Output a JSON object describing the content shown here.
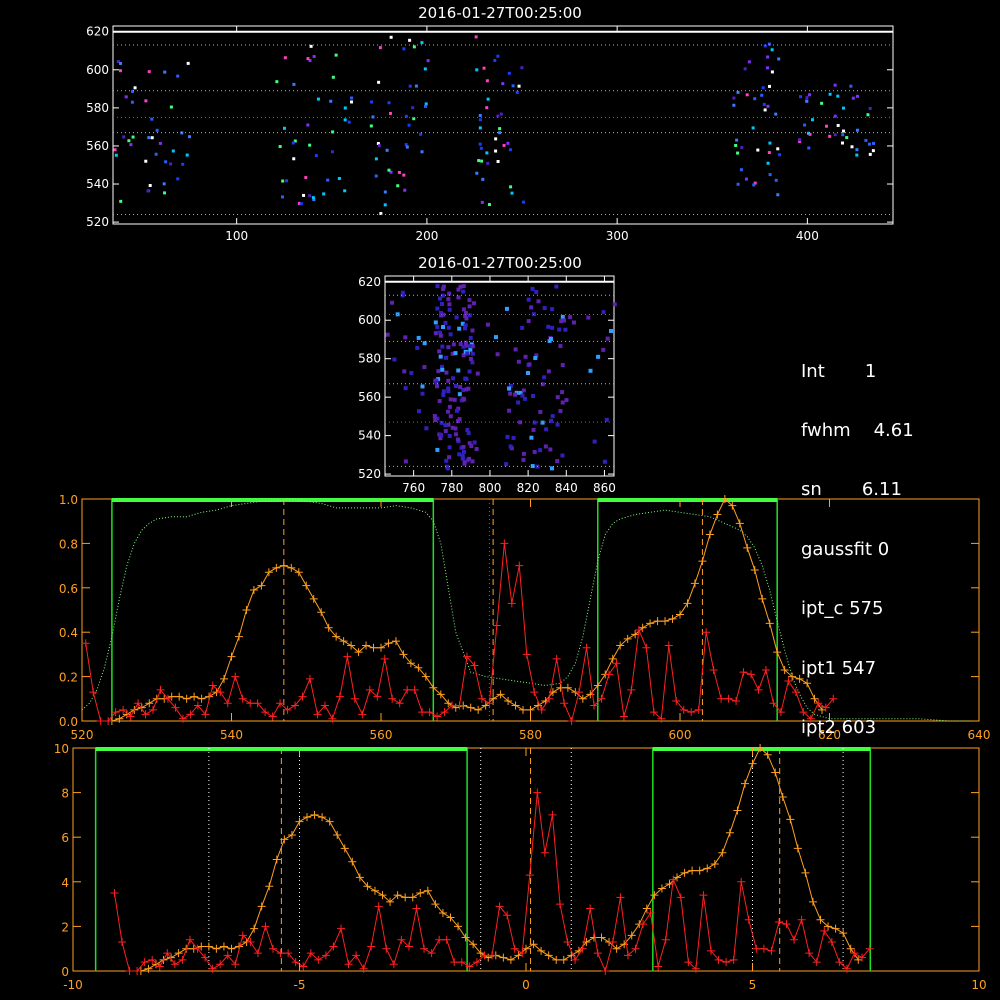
{
  "chart_data": [
    {
      "id": "top",
      "type": "heatmap",
      "title": "2016-01-27T00:25:00",
      "xlim": [
        35,
        445
      ],
      "ylim": [
        519,
        623
      ],
      "xticks": [
        100,
        200,
        300,
        400
      ],
      "yticks": [
        520,
        540,
        560,
        580,
        600,
        620
      ],
      "hlines_green": [
        524,
        567,
        589,
        613
      ],
      "hlines_red": [
        575
      ],
      "hlines_white": [
        620
      ],
      "pixel_clusters": [
        {
          "x_range": [
            35,
            75
          ],
          "y_range": [
            530,
            610
          ]
        },
        {
          "x_range": [
            120,
            160
          ],
          "y_range": [
            528,
            616
          ]
        },
        {
          "x_range": [
            170,
            200
          ],
          "y_range": [
            525,
            620
          ]
        },
        {
          "x_range": [
            225,
            250
          ],
          "y_range": [
            530,
            620
          ]
        },
        {
          "x_range": [
            358,
            385
          ],
          "y_range": [
            535,
            615
          ]
        },
        {
          "x_range": [
            395,
            435
          ],
          "y_range": [
            555,
            595
          ]
        }
      ]
    },
    {
      "id": "mid",
      "type": "heatmap",
      "title": "2016-01-27T00:25:00",
      "xlim": [
        745,
        865
      ],
      "ylim": [
        519,
        623
      ],
      "xticks": [
        760,
        780,
        800,
        820,
        840,
        860
      ],
      "yticks": [
        520,
        540,
        560,
        580,
        600,
        620
      ],
      "hlines_green": [
        524,
        567,
        589,
        613
      ],
      "hlines_red": [
        547,
        603
      ],
      "hlines_white": [
        620
      ]
    },
    {
      "id": "profile1",
      "type": "line",
      "xlim": [
        520,
        640
      ],
      "ylim": [
        0,
        1
      ],
      "xticks": [
        520,
        540,
        560,
        580,
        600,
        620,
        640
      ],
      "yticks": [
        0.0,
        0.2,
        0.4,
        0.6,
        0.8,
        1.0
      ],
      "ytick_labels": [
        "0.0",
        "0.2",
        "0.4",
        "0.6",
        "0.8",
        "1.0"
      ],
      "green_boxes": [
        [
          524,
          567
        ],
        [
          589,
          613
        ]
      ],
      "dashed_lines": [
        547,
        575,
        603
      ],
      "dotted_red_line": 574.5,
      "series": [
        {
          "color": "#ffa020",
          "x": [
            524,
            525,
            526,
            527,
            528,
            529,
            530,
            531,
            532,
            533,
            534,
            535,
            536,
            537,
            538,
            539,
            540,
            541,
            542,
            543,
            544,
            545,
            546,
            547,
            548,
            549,
            550,
            551,
            552,
            553,
            554,
            555,
            556,
            557,
            558,
            559,
            560,
            561,
            562,
            563,
            564,
            565,
            566,
            567,
            568,
            569,
            570,
            571,
            572,
            573,
            574,
            575,
            576,
            577,
            578,
            579,
            580,
            581,
            582,
            583,
            584,
            585,
            586,
            587,
            588,
            589,
            590,
            591,
            592,
            593,
            594,
            595,
            596,
            597,
            598,
            599,
            600,
            601,
            602,
            603,
            604,
            605,
            606,
            607,
            608,
            609,
            610,
            611,
            612,
            613,
            614,
            615,
            616,
            617,
            618,
            619
          ],
          "y": [
            0.0,
            0.01,
            0.03,
            0.05,
            0.06,
            0.08,
            0.1,
            0.1,
            0.11,
            0.11,
            0.1,
            0.11,
            0.1,
            0.11,
            0.13,
            0.19,
            0.29,
            0.38,
            0.5,
            0.59,
            0.61,
            0.67,
            0.69,
            0.7,
            0.69,
            0.67,
            0.61,
            0.55,
            0.49,
            0.42,
            0.38,
            0.36,
            0.34,
            0.31,
            0.34,
            0.33,
            0.33,
            0.35,
            0.36,
            0.3,
            0.26,
            0.24,
            0.2,
            0.15,
            0.12,
            0.08,
            0.06,
            0.07,
            0.06,
            0.05,
            0.07,
            0.1,
            0.12,
            0.09,
            0.07,
            0.05,
            0.05,
            0.07,
            0.09,
            0.13,
            0.15,
            0.15,
            0.13,
            0.1,
            0.12,
            0.16,
            0.21,
            0.28,
            0.34,
            0.37,
            0.39,
            0.42,
            0.44,
            0.45,
            0.45,
            0.46,
            0.48,
            0.53,
            0.62,
            0.72,
            0.84,
            0.93,
            1.0,
            0.97,
            0.89,
            0.78,
            0.68,
            0.55,
            0.44,
            0.31,
            0.23,
            0.2,
            0.19,
            0.17,
            0.1,
            0.05
          ]
        },
        {
          "color": "#ff2020",
          "x": [
            520.5,
            521.5,
            522.5,
            523.5,
            524.5,
            525.5,
            526.5,
            527.5,
            528.5,
            529.5,
            530.5,
            531.5,
            532.5,
            533.5,
            534.5,
            535.5,
            536.5,
            537.5,
            538.5,
            539.5,
            540.5,
            541.5,
            542.5,
            543.5,
            544.5,
            545.5,
            546.5,
            547.5,
            548.5,
            549.5,
            550.5,
            551.5,
            552.5,
            553.5,
            554.5,
            555.5,
            556.5,
            557.5,
            558.5,
            559.5,
            560.5,
            561.5,
            562.5,
            563.5,
            564.5,
            565.5,
            566.5,
            567.5,
            568.5,
            569.5,
            570.5,
            571.5,
            572.5,
            573.5,
            574.5,
            575.5,
            576.5,
            577.5,
            578.5,
            579.5,
            580.5,
            581.5,
            582.5,
            583.5,
            584.5,
            585.5,
            586.5,
            587.5,
            588.5,
            589.5,
            590.5,
            591.5,
            592.5,
            593.5,
            594.5,
            595.5,
            596.5,
            597.5,
            598.5,
            599.5,
            600.5,
            601.5,
            602.5,
            603.5,
            604.5,
            605.5,
            606.5,
            607.5,
            608.5,
            609.5,
            610.5,
            611.5,
            612.5,
            613.5,
            614.5,
            615.5,
            616.5,
            617.5,
            618.5,
            619.5,
            620.5
          ],
          "y": [
            0.35,
            0.13,
            0.0,
            0.0,
            0.04,
            0.05,
            0.02,
            0.08,
            0.03,
            0.05,
            0.14,
            0.1,
            0.06,
            0.01,
            0.03,
            0.07,
            0.03,
            0.16,
            0.13,
            0.08,
            0.2,
            0.1,
            0.08,
            0.08,
            0.04,
            0.02,
            0.08,
            0.05,
            0.07,
            0.11,
            0.19,
            0.03,
            0.07,
            0.01,
            0.11,
            0.29,
            0.1,
            0.03,
            0.14,
            0.11,
            0.28,
            0.1,
            0.08,
            0.14,
            0.14,
            0.04,
            0.04,
            0.02,
            0.04,
            0.07,
            0.07,
            0.29,
            0.25,
            0.1,
            0.08,
            0.43,
            0.8,
            0.53,
            0.7,
            0.3,
            0.13,
            0.05,
            0.1,
            0.28,
            0.08,
            0.0,
            0.13,
            0.33,
            0.07,
            0.1,
            0.21,
            0.26,
            0.02,
            0.14,
            0.41,
            0.33,
            0.04,
            0.01,
            0.34,
            0.09,
            0.05,
            0.04,
            0.05,
            0.4,
            0.23,
            0.1,
            0.1,
            0.09,
            0.22,
            0.21,
            0.14,
            0.23,
            0.08,
            0.04,
            0.18,
            0.13,
            0.04,
            0.01,
            0.08,
            0.06,
            0.1
          ]
        }
      ],
      "dotted_curve": {
        "color": "#80ff80",
        "x": [
          520,
          521,
          522,
          523,
          524,
          525,
          526,
          527,
          528,
          529,
          530,
          532,
          534,
          536,
          538,
          540,
          542,
          544,
          546,
          548,
          550,
          552,
          554,
          556,
          558,
          560,
          562,
          564,
          566,
          567,
          568,
          569,
          570,
          572,
          574,
          576,
          578,
          580,
          582,
          584,
          585,
          586,
          587,
          588,
          589,
          590,
          591,
          592,
          593,
          594,
          596,
          598,
          600,
          602,
          604,
          606,
          608,
          609,
          610,
          611,
          612,
          613,
          614,
          615,
          616,
          617,
          618,
          620,
          624,
          628,
          632,
          636,
          640
        ],
        "y": [
          0.05,
          0.08,
          0.14,
          0.24,
          0.38,
          0.55,
          0.7,
          0.8,
          0.86,
          0.89,
          0.91,
          0.92,
          0.92,
          0.94,
          0.95,
          0.97,
          0.98,
          0.99,
          0.99,
          1.0,
          0.99,
          0.98,
          0.96,
          0.96,
          0.96,
          0.96,
          0.97,
          0.96,
          0.94,
          0.9,
          0.8,
          0.6,
          0.4,
          0.22,
          0.2,
          0.19,
          0.18,
          0.17,
          0.16,
          0.17,
          0.2,
          0.26,
          0.38,
          0.55,
          0.72,
          0.84,
          0.89,
          0.91,
          0.92,
          0.93,
          0.94,
          0.95,
          0.94,
          0.93,
          0.92,
          0.89,
          0.86,
          0.83,
          0.78,
          0.7,
          0.59,
          0.45,
          0.32,
          0.2,
          0.12,
          0.06,
          0.03,
          0.01,
          0.01,
          0.01,
          0.01,
          0.0,
          0.0
        ]
      }
    },
    {
      "id": "profile2",
      "type": "line",
      "xlim": [
        -10,
        10
      ],
      "ylim": [
        0,
        10
      ],
      "xticks": [
        -10,
        -5,
        0,
        5,
        10
      ],
      "yticks": [
        0,
        2,
        4,
        6,
        8,
        10
      ],
      "ytick_labels": [
        "0",
        "2",
        "4",
        "6",
        "8",
        "10"
      ],
      "green_boxes": [
        [
          -9.5,
          -1.3
        ],
        [
          2.8,
          7.6
        ]
      ],
      "dashed_lines": [
        -5.4,
        0.1,
        5.6
      ],
      "dotted_white_lines": [
        -7.0,
        -5.0,
        -1.0,
        1.0,
        5.0,
        7.0
      ],
      "series_scaled_from": "profile1",
      "x_offset": 575,
      "x_scale": 0.1667,
      "y_scale": 10
    }
  ],
  "info": {
    "lines": [
      "Int       1",
      "fwhm    4.61",
      "sn       6.11",
      "gaussfit 0",
      "ipt_c 575",
      "ipt1 547",
      "ipt2 603"
    ]
  }
}
